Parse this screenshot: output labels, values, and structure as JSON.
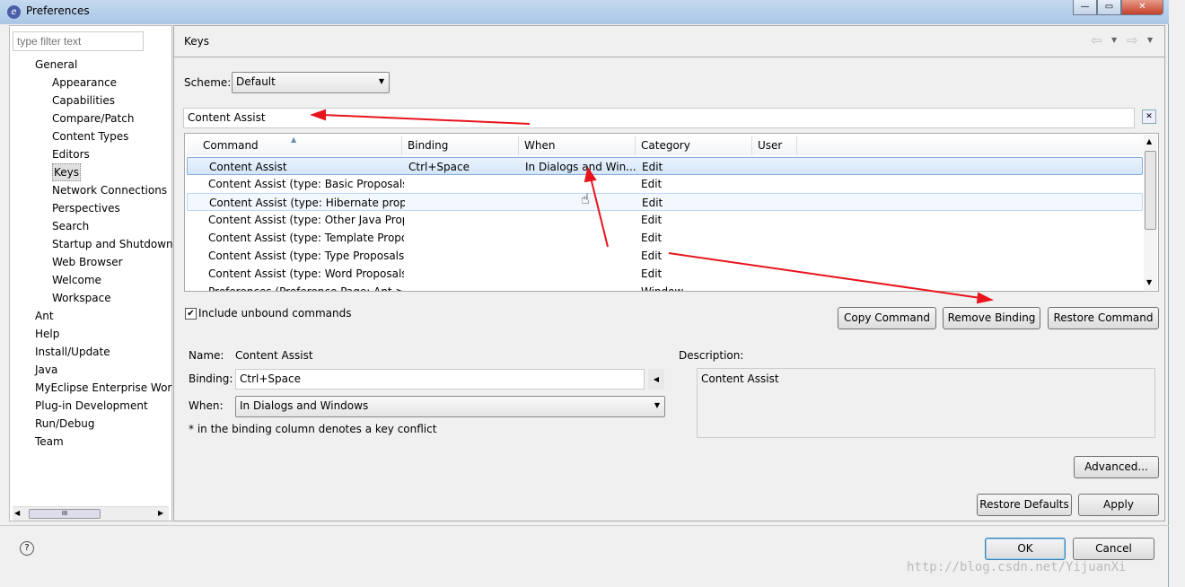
{
  "window": {
    "title": "Preferences",
    "minimize": "—",
    "maximize": "▭",
    "close": "✕"
  },
  "sidebar": {
    "filter_placeholder": "type filter text",
    "items": [
      {
        "label": "General",
        "level": 0
      },
      {
        "label": "Appearance",
        "level": 1
      },
      {
        "label": "Capabilities",
        "level": 1
      },
      {
        "label": "Compare/Patch",
        "level": 1
      },
      {
        "label": "Content Types",
        "level": 1
      },
      {
        "label": "Editors",
        "level": 1
      },
      {
        "label": "Keys",
        "level": 1,
        "selected": true
      },
      {
        "label": "Network Connections",
        "level": 1
      },
      {
        "label": "Perspectives",
        "level": 1
      },
      {
        "label": "Search",
        "level": 1
      },
      {
        "label": "Startup and Shutdown",
        "level": 1
      },
      {
        "label": "Web Browser",
        "level": 1
      },
      {
        "label": "Welcome",
        "level": 1
      },
      {
        "label": "Workspace",
        "level": 1
      },
      {
        "label": "Ant",
        "level": 0
      },
      {
        "label": "Help",
        "level": 0
      },
      {
        "label": "Install/Update",
        "level": 0
      },
      {
        "label": "Java",
        "level": 0
      },
      {
        "label": "MyEclipse Enterprise Wor",
        "level": 0
      },
      {
        "label": "Plug-in Development",
        "level": 0
      },
      {
        "label": "Run/Debug",
        "level": 0
      },
      {
        "label": "Team",
        "level": 0
      }
    ],
    "scroll_grip": "III"
  },
  "page": {
    "title": "Keys",
    "scheme_label": "Scheme:",
    "scheme_value": "Default",
    "filter_value": "Content Assist",
    "table": {
      "columns": [
        "Command",
        "Binding",
        "When",
        "Category",
        "User"
      ],
      "rows": [
        {
          "command": "Content Assist",
          "binding": "Ctrl+Space",
          "when": "In Dialogs and Win...",
          "category": "Edit",
          "user": "",
          "state": "selected"
        },
        {
          "command": "Content Assist (type: Basic Proposals)",
          "binding": "",
          "when": "",
          "category": "Edit",
          "user": ""
        },
        {
          "command": "Content Assist (type: Hibernate propo",
          "binding": "",
          "when": "",
          "category": "Edit",
          "user": "",
          "state": "hover"
        },
        {
          "command": "Content Assist (type: Other Java Prop",
          "binding": "",
          "when": "",
          "category": "Edit",
          "user": ""
        },
        {
          "command": "Content Assist (type: Template Propo",
          "binding": "",
          "when": "",
          "category": "Edit",
          "user": ""
        },
        {
          "command": "Content Assist (type: Type Proposals)",
          "binding": "",
          "when": "",
          "category": "Edit",
          "user": ""
        },
        {
          "command": "Content Assist (type: Word Proposals",
          "binding": "",
          "when": "",
          "category": "Edit",
          "user": ""
        },
        {
          "command": "Preferences (Preference Page: Ant > I",
          "binding": "",
          "when": "",
          "category": "Window",
          "user": ""
        }
      ]
    },
    "include_unbound_label": "Include unbound commands",
    "include_unbound_checked": true,
    "copy_command": "Copy Command",
    "remove_binding": "Remove Binding",
    "restore_command": "Restore Command",
    "name_label": "Name:",
    "name_value": "Content Assist",
    "binding_label": "Binding:",
    "binding_value": "Ctrl+Space",
    "when_label": "When:",
    "when_value": "In Dialogs and Windows",
    "conflict_note": "* in the binding column denotes a key conflict",
    "description_label": "Description:",
    "description_value": "Content Assist",
    "advanced": "Advanced...",
    "restore_defaults": "Restore Defaults",
    "apply": "Apply"
  },
  "footer": {
    "help": "?",
    "ok": "OK",
    "cancel": "Cancel"
  },
  "watermark": "http://blog.csdn.net/YijuanXi",
  "annotation_color": "#e8141c"
}
